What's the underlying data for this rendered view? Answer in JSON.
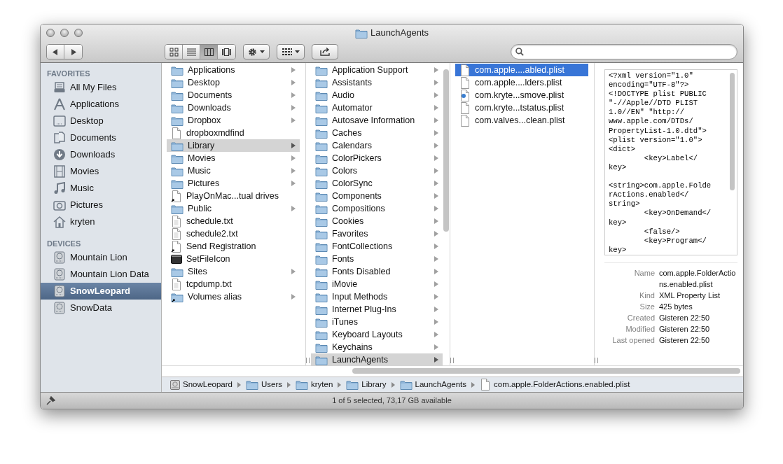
{
  "window": {
    "title": "LaunchAgents"
  },
  "toolbar": {
    "view_buttons": [
      {
        "kind": "icons",
        "selected": false
      },
      {
        "kind": "list",
        "selected": false
      },
      {
        "kind": "columns",
        "selected": true
      },
      {
        "kind": "coverflow",
        "selected": false
      }
    ]
  },
  "sidebar": {
    "sections": [
      {
        "title": "FAVORITES",
        "items": [
          {
            "label": "All My Files",
            "kind": "files",
            "selected": false
          },
          {
            "label": "Applications",
            "kind": "apps",
            "selected": false
          },
          {
            "label": "Desktop",
            "kind": "desktop",
            "selected": false
          },
          {
            "label": "Documents",
            "kind": "documents",
            "selected": false
          },
          {
            "label": "Downloads",
            "kind": "downloads",
            "selected": false
          },
          {
            "label": "Movies",
            "kind": "movies",
            "selected": false
          },
          {
            "label": "Music",
            "kind": "music",
            "selected": false
          },
          {
            "label": "Pictures",
            "kind": "pictures",
            "selected": false
          },
          {
            "label": "kryten",
            "kind": "home",
            "selected": false
          }
        ]
      },
      {
        "title": "DEVICES",
        "items": [
          {
            "label": "Mountain Lion",
            "kind": "disk",
            "selected": false
          },
          {
            "label": "Mountain Lion Data",
            "kind": "disk",
            "selected": false
          },
          {
            "label": "SnowLeopard",
            "kind": "disk",
            "selected": true
          },
          {
            "label": "SnowData",
            "kind": "disk",
            "selected": false
          }
        ]
      }
    ]
  },
  "columns": [
    {
      "focused": false,
      "scrollbar": false,
      "items": [
        {
          "label": "Applications",
          "kind": "folder",
          "has_children": true,
          "selected": false
        },
        {
          "label": "Desktop",
          "kind": "folder",
          "has_children": true,
          "selected": false
        },
        {
          "label": "Documents",
          "kind": "folder",
          "has_children": true,
          "selected": false
        },
        {
          "label": "Downloads",
          "kind": "folder",
          "has_children": true,
          "selected": false
        },
        {
          "label": "Dropbox",
          "kind": "folder",
          "has_children": true,
          "selected": false
        },
        {
          "label": "dropboxmdfind",
          "kind": "file",
          "has_children": false,
          "selected": false
        },
        {
          "label": "Library",
          "kind": "folder",
          "has_children": true,
          "selected": true
        },
        {
          "label": "Movies",
          "kind": "folder",
          "has_children": true,
          "selected": false
        },
        {
          "label": "Music",
          "kind": "folder",
          "has_children": true,
          "selected": false
        },
        {
          "label": "Pictures",
          "kind": "folder",
          "has_children": true,
          "selected": false
        },
        {
          "label": "PlayOnMac...tual drives",
          "kind": "alias",
          "has_children": false,
          "selected": false
        },
        {
          "label": "Public",
          "kind": "folder",
          "has_children": true,
          "selected": false
        },
        {
          "label": "schedule.txt",
          "kind": "text",
          "has_children": false,
          "selected": false
        },
        {
          "label": "schedule2.txt",
          "kind": "text",
          "has_children": false,
          "selected": false
        },
        {
          "label": "Send Registration",
          "kind": "alias",
          "has_children": false,
          "selected": false
        },
        {
          "label": "SetFileIcon",
          "kind": "app",
          "has_children": false,
          "selected": false
        },
        {
          "label": "Sites",
          "kind": "folder",
          "has_children": true,
          "selected": false
        },
        {
          "label": "tcpdump.txt",
          "kind": "text",
          "has_children": false,
          "selected": false
        },
        {
          "label": "Volumes alias",
          "kind": "folder-alias",
          "has_children": true,
          "selected": false
        }
      ]
    },
    {
      "focused": false,
      "scrollbar": true,
      "items": [
        {
          "label": "Application Support",
          "kind": "folder",
          "has_children": true,
          "selected": false
        },
        {
          "label": "Assistants",
          "kind": "folder",
          "has_children": true,
          "selected": false
        },
        {
          "label": "Audio",
          "kind": "folder",
          "has_children": true,
          "selected": false
        },
        {
          "label": "Automator",
          "kind": "folder",
          "has_children": true,
          "selected": false
        },
        {
          "label": "Autosave Information",
          "kind": "folder",
          "has_children": true,
          "selected": false
        },
        {
          "label": "Caches",
          "kind": "folder",
          "has_children": true,
          "selected": false
        },
        {
          "label": "Calendars",
          "kind": "folder",
          "has_children": true,
          "selected": false
        },
        {
          "label": "ColorPickers",
          "kind": "folder",
          "has_children": true,
          "selected": false
        },
        {
          "label": "Colors",
          "kind": "folder",
          "has_children": true,
          "selected": false
        },
        {
          "label": "ColorSync",
          "kind": "folder",
          "has_children": true,
          "selected": false
        },
        {
          "label": "Components",
          "kind": "folder",
          "has_children": true,
          "selected": false
        },
        {
          "label": "Compositions",
          "kind": "folder",
          "has_children": true,
          "selected": false
        },
        {
          "label": "Cookies",
          "kind": "folder",
          "has_children": true,
          "selected": false
        },
        {
          "label": "Favorites",
          "kind": "folder",
          "has_children": true,
          "selected": false
        },
        {
          "label": "FontCollections",
          "kind": "folder",
          "has_children": true,
          "selected": false
        },
        {
          "label": "Fonts",
          "kind": "folder",
          "has_children": true,
          "selected": false
        },
        {
          "label": "Fonts Disabled",
          "kind": "folder",
          "has_children": true,
          "selected": false
        },
        {
          "label": "iMovie",
          "kind": "folder",
          "has_children": true,
          "selected": false
        },
        {
          "label": "Input Methods",
          "kind": "folder",
          "has_children": true,
          "selected": false
        },
        {
          "label": "Internet Plug-Ins",
          "kind": "folder",
          "has_children": true,
          "selected": false
        },
        {
          "label": "iTunes",
          "kind": "folder",
          "has_children": true,
          "selected": false
        },
        {
          "label": "Keyboard Layouts",
          "kind": "folder",
          "has_children": true,
          "selected": false
        },
        {
          "label": "Keychains",
          "kind": "folder",
          "has_children": true,
          "selected": false
        },
        {
          "label": "LaunchAgents",
          "kind": "folder",
          "has_children": true,
          "selected": true
        }
      ]
    },
    {
      "focused": true,
      "scrollbar": false,
      "items": [
        {
          "label": "com.apple....abled.plist",
          "kind": "file",
          "has_children": false,
          "selected": true
        },
        {
          "label": "com.apple....lders.plist",
          "kind": "file",
          "has_children": false,
          "selected": false
        },
        {
          "label": "com.kryte...smove.plist",
          "kind": "badge-file",
          "has_children": false,
          "selected": false
        },
        {
          "label": "com.kryte...tstatus.plist",
          "kind": "file",
          "has_children": false,
          "selected": false
        },
        {
          "label": "com.valves...clean.plist",
          "kind": "file",
          "has_children": false,
          "selected": false
        }
      ]
    }
  ],
  "preview": {
    "text": "<?xml version=\"1.0\"\nencoding=\"UTF-8\"?>\n<!DOCTYPE plist PUBLIC\n\"-//Apple//DTD PLIST\n1.0//EN\" \"http://\nwww.apple.com/DTDs/\nPropertyList-1.0.dtd\">\n<plist version=\"1.0\">\n<dict>\n        <key>Label</\nkey>\n\n<string>com.apple.Folde\nrActions.enabled</\nstring>\n        <key>OnDemand</\nkey>\n        <false/>\n        <key>Program</\nkey>",
    "info": [
      {
        "label": "Name",
        "value": "com.apple.FolderActions.enabled.plist"
      },
      {
        "label": "Kind",
        "value": "XML Property List"
      },
      {
        "label": "Size",
        "value": "425 bytes"
      },
      {
        "label": "Created",
        "value": "Gisteren 22:50"
      },
      {
        "label": "Modified",
        "value": "Gisteren 22:50"
      },
      {
        "label": "Last opened",
        "value": "Gisteren 22:50"
      }
    ]
  },
  "path_bar": [
    {
      "label": "SnowLeopard",
      "kind": "disk"
    },
    {
      "label": "Users",
      "kind": "folder"
    },
    {
      "label": "kryten",
      "kind": "folder"
    },
    {
      "label": "Library",
      "kind": "folder"
    },
    {
      "label": "LaunchAgents",
      "kind": "folder"
    },
    {
      "label": "com.apple.FolderActions.enabled.plist",
      "kind": "file"
    }
  ],
  "status_bar": {
    "text": "1 of 5 selected, 73,17 GB available"
  }
}
